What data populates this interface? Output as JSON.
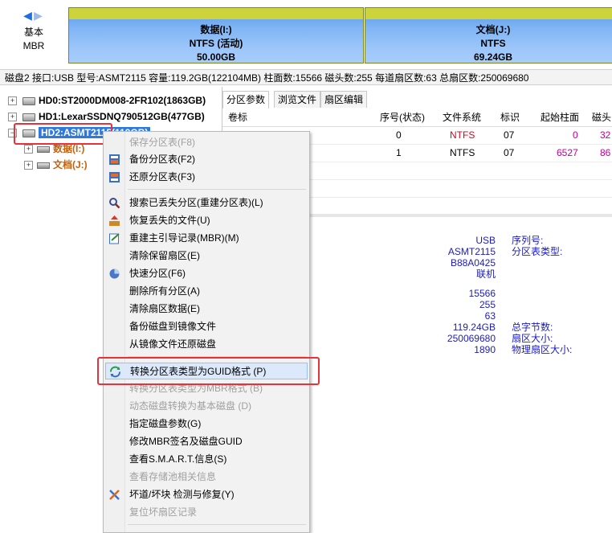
{
  "nav": {
    "back": "◀",
    "forward": "▶"
  },
  "disk_kind": {
    "line1": "基本",
    "line2": "MBR"
  },
  "partitions": [
    {
      "name": "数据(I:)",
      "fs": "NTFS (活动)",
      "size": "50.00GB"
    },
    {
      "name": "文档(J:)",
      "fs": "NTFS",
      "size": "69.24GB"
    }
  ],
  "disk_info": "磁盘2 接口:USB  型号:ASMT2115  容量:119.2GB(122104MB)  柱面数:15566  磁头数:255  每道扇区数:63  总扇区数:250069680",
  "tree": {
    "hd0": "HD0:ST2000DM008-2FR102(1863GB)",
    "hd1": "HD1:LexarSSDNQ790512GB(477GB)",
    "hd2": "HD2:ASMT2115(119GB)",
    "vol_i": "数据(I:)",
    "vol_j": "文档(J:)"
  },
  "tabs": [
    "分区参数",
    "浏览文件",
    "扇区编辑"
  ],
  "table": {
    "headers": [
      "卷标",
      "序号(状态)",
      "文件系统",
      "标识",
      "起始柱面",
      "磁头"
    ],
    "rows": [
      {
        "index": "0",
        "fs": "NTFS",
        "id": "07",
        "start_cyl": "0",
        "head": "32"
      },
      {
        "index": "1",
        "fs": "NTFS",
        "id": "07",
        "start_cyl": "6527",
        "head": "86"
      }
    ]
  },
  "details": {
    "values": [
      "USB",
      "ASMT2115",
      "B88A0425",
      "联机",
      "15566",
      "255",
      "63",
      "119.24GB",
      "250069680",
      "1890"
    ],
    "labels": [
      "序列号:",
      "分区表类型:",
      "总字节数:",
      "扇区大小:",
      "物理扇区大小:"
    ]
  },
  "menu": {
    "items": [
      {
        "label": "保存分区表(F8)",
        "disabled": true,
        "icon": ""
      },
      {
        "label": "备份分区表(F2)",
        "disabled": false,
        "icon": "backup-table-icon"
      },
      {
        "label": "还原分区表(F3)",
        "disabled": false,
        "icon": "restore-table-icon"
      },
      {
        "label": "搜索已丢失分区(重建分区表)(L)",
        "disabled": false,
        "icon": "search-icon"
      },
      {
        "label": "恢复丢失的文件(U)",
        "disabled": false,
        "icon": "recover-files-icon"
      },
      {
        "label": "重建主引导记录(MBR)(M)",
        "disabled": false,
        "icon": "rebuild-mbr-icon"
      },
      {
        "label": "清除保留扇区(E)",
        "disabled": false,
        "icon": ""
      },
      {
        "label": "快速分区(F6)",
        "disabled": false,
        "icon": "quick-partition-icon"
      },
      {
        "label": "删除所有分区(A)",
        "disabled": false,
        "icon": ""
      },
      {
        "label": "清除扇区数据(E)",
        "disabled": false,
        "icon": ""
      },
      {
        "label": "备份磁盘到镜像文件",
        "disabled": false,
        "icon": ""
      },
      {
        "label": "从镜像文件还原磁盘",
        "disabled": false,
        "icon": ""
      },
      {
        "label": "转换分区表类型为GUID格式 (P)",
        "disabled": false,
        "icon": "convert-guid-icon"
      },
      {
        "label": "转换分区表类型为MBR格式 (B)",
        "disabled": true,
        "icon": ""
      },
      {
        "label": "动态磁盘转换为基本磁盘 (D)",
        "disabled": true,
        "icon": ""
      },
      {
        "label": "指定磁盘参数(G)",
        "disabled": false,
        "icon": ""
      },
      {
        "label": "修改MBR签名及磁盘GUID",
        "disabled": false,
        "icon": ""
      },
      {
        "label": "查看S.M.A.R.T.信息(S)",
        "disabled": false,
        "icon": ""
      },
      {
        "label": "查看存储池相关信息",
        "disabled": true,
        "icon": ""
      },
      {
        "label": "坏道/坏块 检测与修复(Y)",
        "disabled": false,
        "icon": "tools-icon"
      },
      {
        "label": "复位坏扇区记录",
        "disabled": true,
        "icon": ""
      }
    ]
  },
  "colors": {
    "selection": "#3079d8",
    "highlight_box": "#e6333b",
    "value_blue": "#1b1bbf",
    "fs_red": "#e0001a"
  }
}
